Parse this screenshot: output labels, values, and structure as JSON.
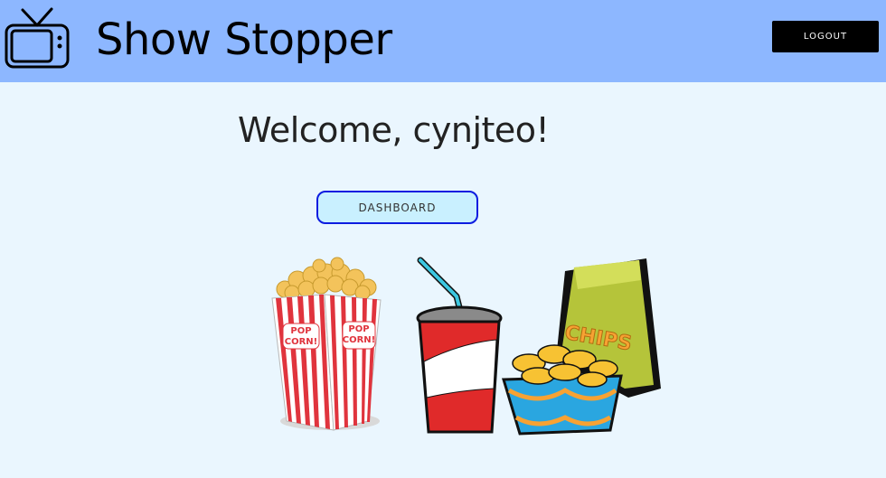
{
  "header": {
    "app_title": "Show Stopper",
    "logo_icon": "tv-icon",
    "logout_label": "LOGOUT"
  },
  "main": {
    "welcome_text": "Welcome, cynjteo!",
    "dashboard_label": "DASHBOARD",
    "illustration": {
      "icons": [
        "popcorn-icon",
        "soda-cup-icon",
        "chips-bowl-icon",
        "chips-bag-icon"
      ],
      "popcorn_text_top": "POP",
      "popcorn_text_bottom": "CORN!",
      "chips_text": "CHIPS"
    }
  },
  "colors": {
    "header_bg": "#8db7ff",
    "page_bg": "#eaf6fe",
    "dashboard_bg": "#c9f0ff",
    "dashboard_border": "#0d1ce0",
    "logout_bg": "#000000"
  }
}
